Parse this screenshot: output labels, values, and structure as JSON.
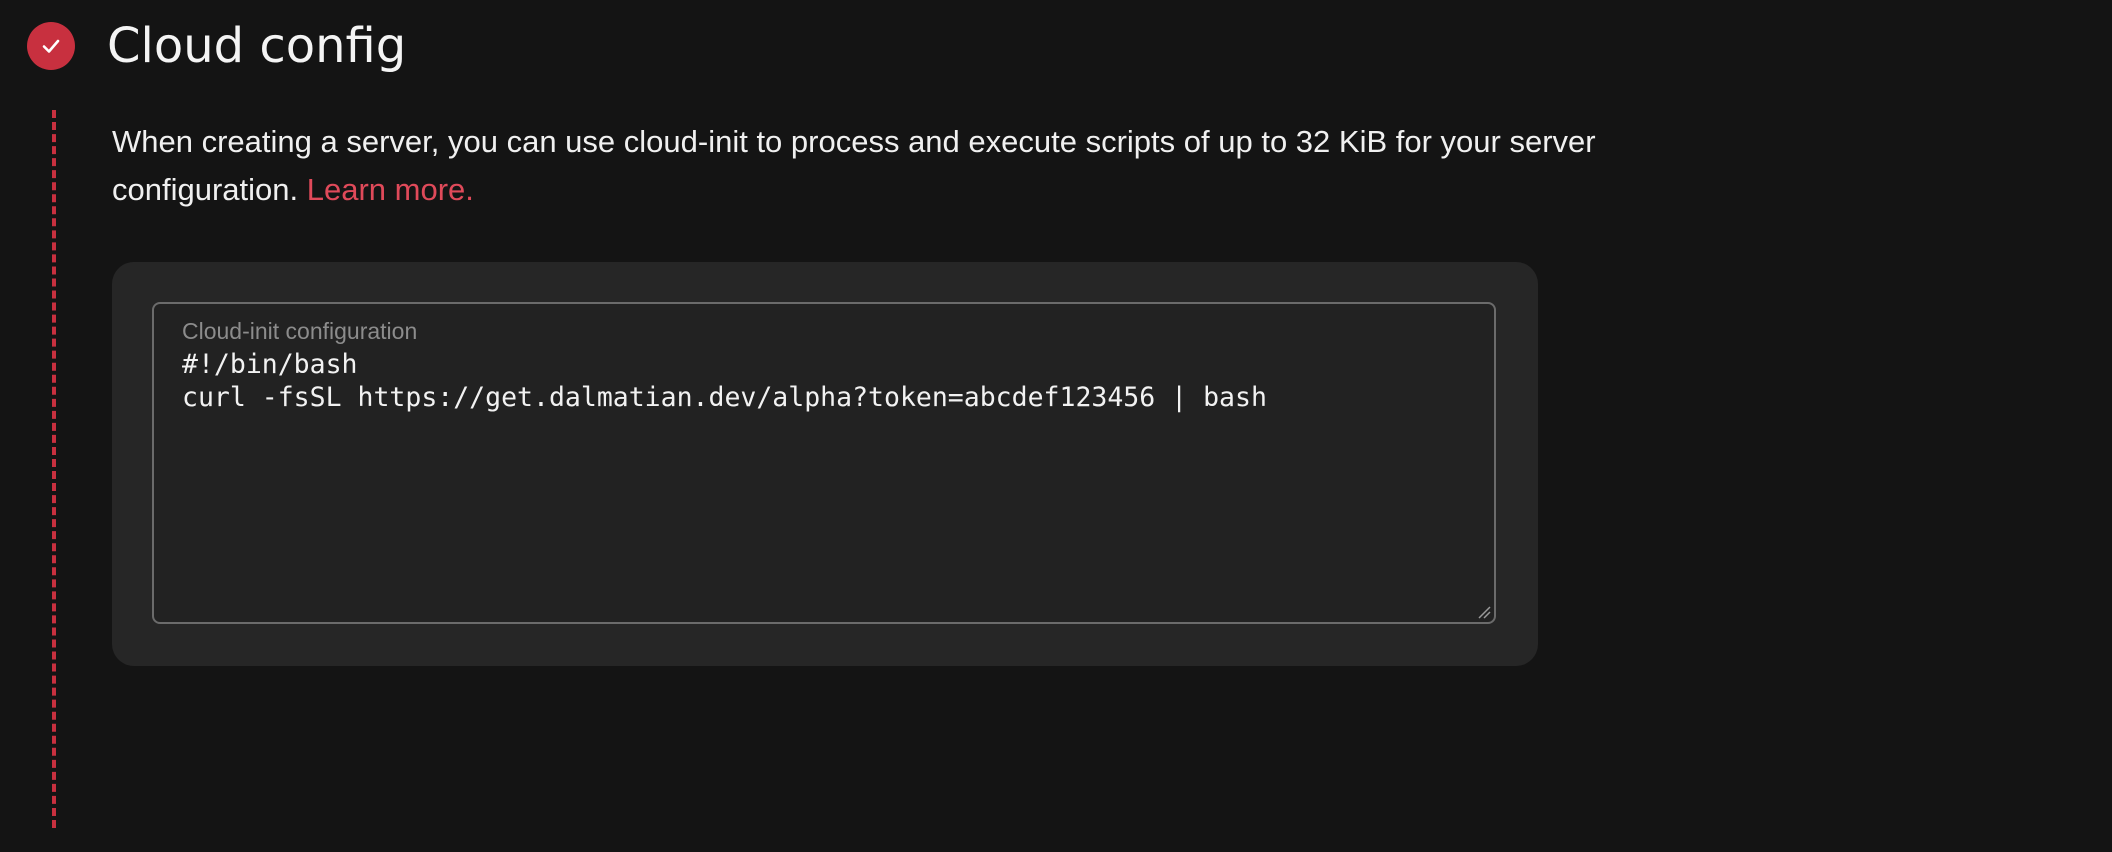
{
  "step": {
    "title": "Cloud config",
    "status_icon": "check-icon",
    "accent_color": "#c8303f"
  },
  "description": {
    "text": "When creating a server, you can use cloud-init to process and execute scripts of up to 32 KiB for your server configuration.",
    "link_label": "Learn more.",
    "link_color": "#e04a5a"
  },
  "cloud_init": {
    "label": "Cloud-init configuration",
    "value": "#!/bin/bash\ncurl -fsSL https://get.dalmatian.dev/alpha?token=abcdef123456 | bash"
  }
}
